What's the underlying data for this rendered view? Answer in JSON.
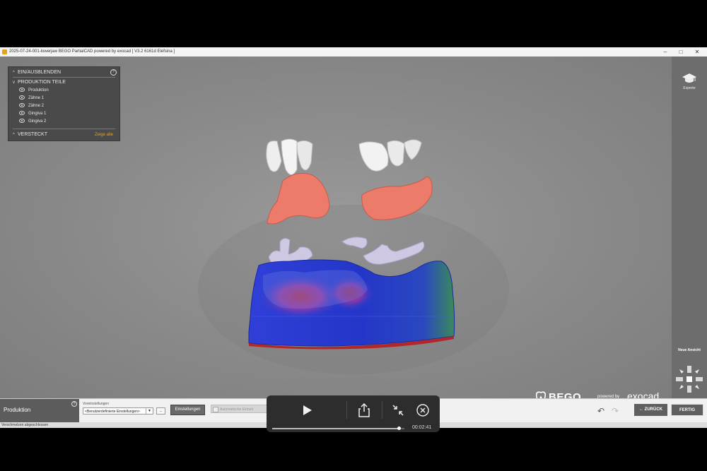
{
  "window": {
    "title": "2025-07-24-001-lowerjaw BEGO PartialCAD powered by exocad [ V3.2 6161d Elefsina ]",
    "minimize": "–",
    "maximize": "□",
    "close": "✕"
  },
  "panel": {
    "section1": "EIN/AUSBLENDEN",
    "help": "?",
    "group": "PRODUKTION TEILE",
    "items": [
      "Produktion",
      "Zähne 1",
      "Zähne 2",
      "Gingiva 1",
      "Gingiva 2"
    ],
    "hidden": "VERSTECKT",
    "show_all": "Zeige alle"
  },
  "rightbar": {
    "experts": "Experte",
    "new_view": "Neue Ansicht"
  },
  "bottombar": {
    "step_label": "Produktion",
    "help": "?",
    "field_label": "Voreinstellungen",
    "select_value": "<Benutzerdefinierte Einstellungen>",
    "dots_label": "...",
    "settings_button": "Einstellungen",
    "checkbox_label": "Automatische Einheit",
    "back_button": "ZURÜCK",
    "finish_button": "FERTIG"
  },
  "logo": {
    "brand": "BEGO",
    "powered": "powered by",
    "partner": "exocad"
  },
  "status": {
    "text": "Verschmelzen abgeschlossen"
  },
  "player": {
    "time": "00:02:41",
    "progress": 0.96
  },
  "colors": {
    "accent": "#e7a21c",
    "teeth": "#f2f2f2",
    "gingiva": "#ec7b6a",
    "clasp": "#c9c3dc",
    "model": "#2233cc"
  }
}
